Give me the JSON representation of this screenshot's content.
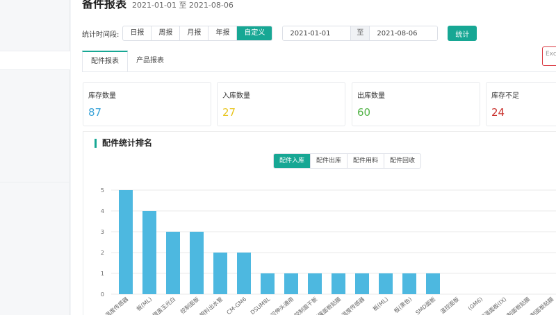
{
  "header": {
    "title": "备件报表",
    "subtitle": "2021-01-01 至 2021-08-06"
  },
  "filter": {
    "label": "统计时间段:",
    "periods": [
      "日报",
      "周报",
      "月报",
      "年报",
      "自定义"
    ],
    "active_period": "自定义",
    "start_date": "2021-01-01",
    "separator": "至",
    "end_date": "2021-08-06",
    "submit_label": "统计"
  },
  "export_label": "Exc",
  "tabs": [
    {
      "label": "配件报表",
      "active": true
    },
    {
      "label": "产品报表",
      "active": false
    }
  ],
  "cards": [
    {
      "label": "库存数量",
      "value": "87",
      "color": "#3aa3d8"
    },
    {
      "label": "入库数量",
      "value": "27",
      "color": "#e8c51e"
    },
    {
      "label": "出库数量",
      "value": "60",
      "color": "#52b347"
    },
    {
      "label": "库存不足",
      "value": "24",
      "color": "#c9302c"
    }
  ],
  "panel": {
    "title": "配件统计排名",
    "chart_tabs": [
      "配件入库",
      "配件出库",
      "配件用料",
      "配件回收"
    ],
    "active_chart_tab": "配件入库"
  },
  "colors": {
    "accent": "#17a794",
    "bar": "#4db8e0",
    "grid": "#e8e8e8",
    "export_border": "#d9363e"
  },
  "chart_data": {
    "type": "bar",
    "title": "",
    "xlabel": "",
    "ylabel": "",
    "ylim": [
      0,
      5
    ],
    "yticks": [
      0,
      1,
      2,
      3,
      4,
      5
    ],
    "grid": true,
    "categories": [
      "温度传感器",
      "板(ML)",
      "增盖玉光白",
      "控制面板",
      "照料出水管",
      "CM-GM6",
      "DSUM8L",
      "可伸头通用",
      "控制面干板",
      "开展面板贴膜",
      "温度传感器",
      "板(ML)",
      "板(黑色)",
      "SMD面板",
      "温控面板",
      "(GM6)",
      "保温面板(IX)",
      "控制面板贴膜",
      "控制面板贴膜"
    ],
    "values": [
      5,
      4,
      3,
      3,
      2,
      2,
      1,
      1,
      1,
      1,
      1,
      1,
      1,
      1,
      0,
      0,
      0,
      0,
      0
    ]
  }
}
